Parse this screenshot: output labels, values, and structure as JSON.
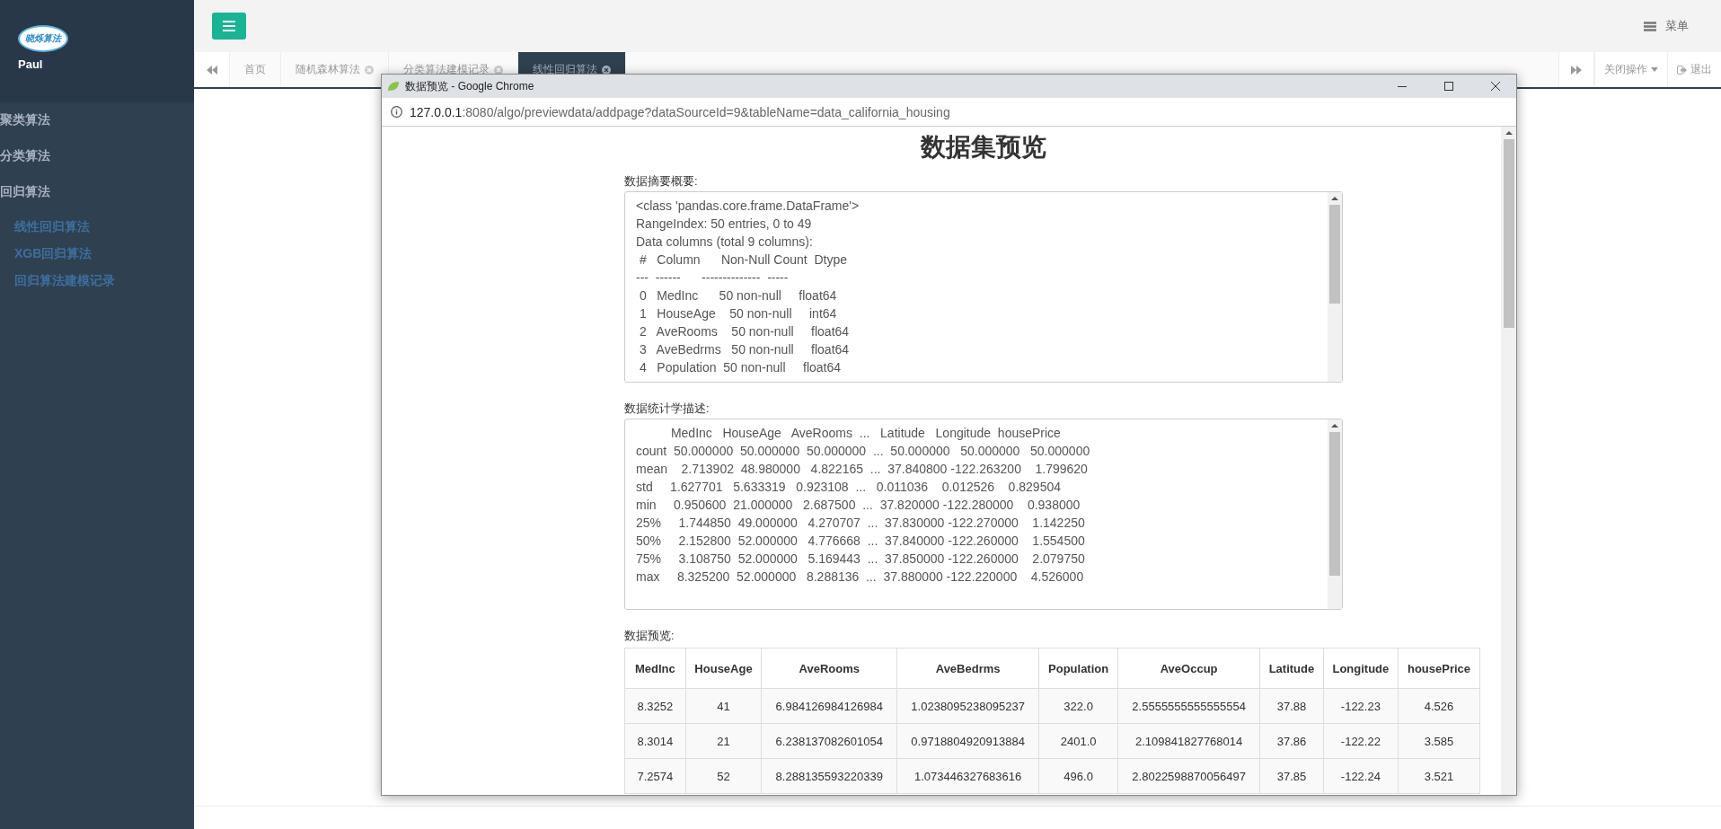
{
  "sidebar": {
    "logo_text": "晓烁算法",
    "user": "Paul",
    "menu": [
      {
        "label": "聚类算法"
      },
      {
        "label": "分类算法"
      },
      {
        "label": "回归算法",
        "children": [
          {
            "label": "线性回归算法"
          },
          {
            "label": "XGB回归算法"
          },
          {
            "label": "回归算法建模记录"
          }
        ]
      }
    ]
  },
  "header": {
    "menu_label": "菜单"
  },
  "tabs": [
    {
      "label": "首页",
      "closable": false,
      "selected": false
    },
    {
      "label": "随机森林算法",
      "closable": true,
      "selected": false
    },
    {
      "label": "分类算法建模记录",
      "closable": true,
      "selected": false
    },
    {
      "label": "线性回归算法",
      "closable": true,
      "selected": true
    }
  ],
  "tab_actions": {
    "close_label": "关闭操作",
    "logout_label": "退出"
  },
  "popup": {
    "title": "数据预览 - Google Chrome",
    "url_host": "127.0.0.1",
    "url_rest": ":8080/algo/previewdata/addpage?dataSourceId=9&tableName=data_california_housing",
    "heading": "数据集预览",
    "sections": [
      {
        "label": "数据摘要概要:",
        "lines": [
          "<class 'pandas.core.frame.DataFrame'>",
          "RangeIndex: 50 entries, 0 to 49",
          "Data columns (total 9 columns):",
          " #   Column      Non-Null Count  Dtype  ",
          "---  ------      --------------  -----  ",
          " 0   MedInc      50 non-null     float64",
          " 1   HouseAge    50 non-null     int64  ",
          " 2   AveRooms    50 non-null     float64",
          " 3   AveBedrms   50 non-null     float64",
          " 4   Population  50 non-null     float64"
        ]
      },
      {
        "label": "数据统计学描述:",
        "lines": [
          "          MedInc   HouseAge   AveRooms  ...   Latitude   Longitude  housePrice",
          "count  50.000000  50.000000  50.000000  ...  50.000000   50.000000   50.000000",
          "mean    2.713902  48.980000   4.822165  ...  37.840800 -122.263200    1.799620",
          "std     1.627701   5.633319   0.923108  ...   0.011036    0.012526    0.829504",
          "min     0.950600  21.000000   2.687500  ...  37.820000 -122.280000    0.938000",
          "25%     1.744850  49.000000   4.270707  ...  37.830000 -122.270000    1.142250",
          "50%     2.152800  52.000000   4.776668  ...  37.840000 -122.260000    1.554500",
          "75%     3.108750  52.000000   5.169443  ...  37.850000 -122.260000    2.079750",
          "max     8.325200  52.000000   8.288136  ...  37.880000 -122.220000    4.526000"
        ]
      }
    ],
    "table_label": "数据预览:",
    "table": {
      "columns": [
        "MedInc",
        "HouseAge",
        "AveRooms",
        "AveBedrms",
        "Population",
        "AveOccup",
        "Latitude",
        "Longitude",
        "housePrice"
      ],
      "rows": [
        [
          "8.3252",
          "41",
          "6.984126984126984",
          "1.0238095238095237",
          "322.0",
          "2.5555555555555554",
          "37.88",
          "-122.23",
          "4.526"
        ],
        [
          "8.3014",
          "21",
          "6.238137082601054",
          "0.9718804920913884",
          "2401.0",
          "2.109841827768014",
          "37.86",
          "-122.22",
          "3.585"
        ],
        [
          "7.2574",
          "52",
          "8.288135593220339",
          "1.073446327683616",
          "496.0",
          "2.8022598870056497",
          "37.85",
          "-122.24",
          "3.521"
        ]
      ]
    }
  }
}
